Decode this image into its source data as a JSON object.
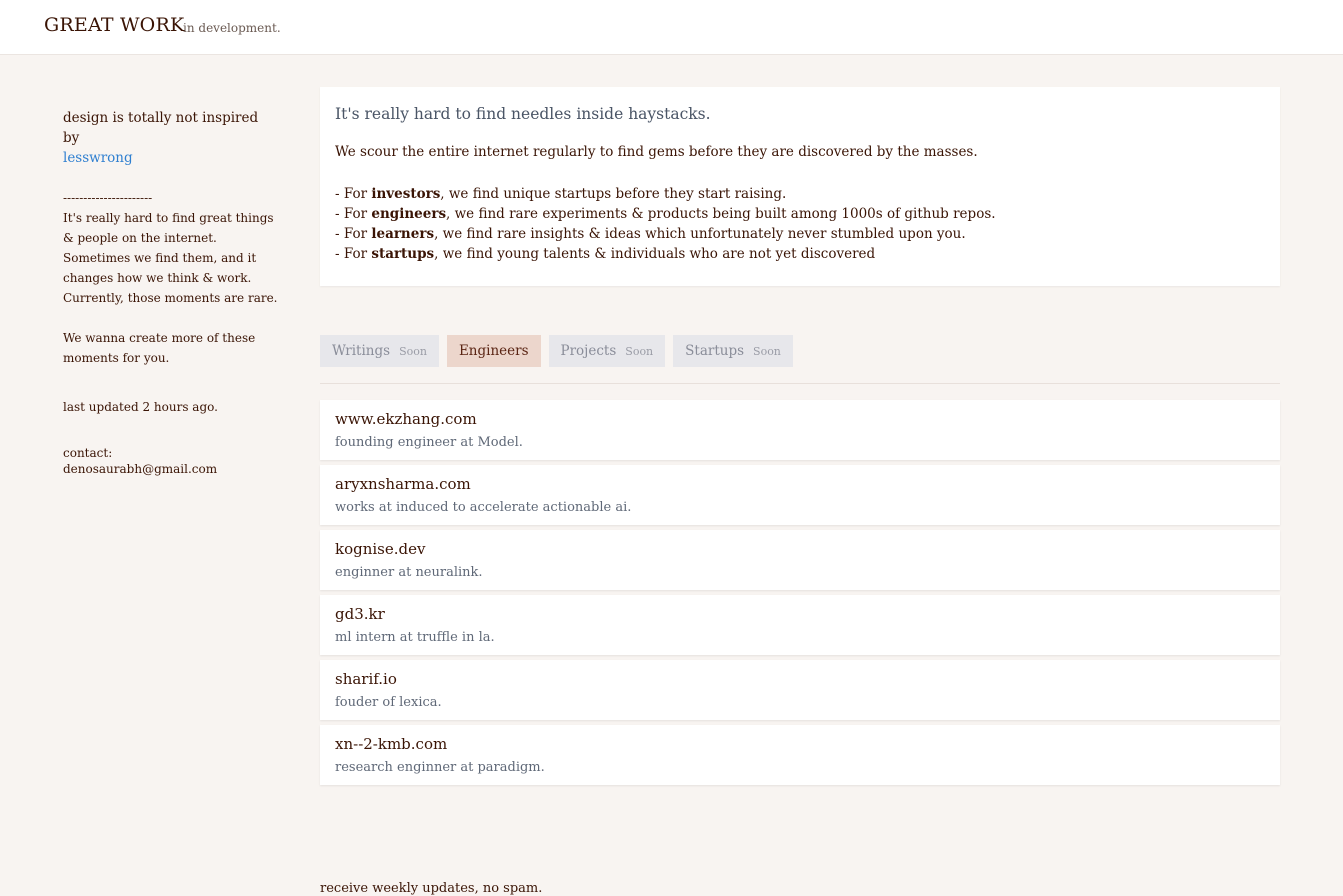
{
  "header": {
    "brand": "GREAT WORK",
    "subtitle": "in development."
  },
  "sidebar": {
    "intro_text": "design is totally not inspired by",
    "intro_link": "lesswrong",
    "separator": "----------------------",
    "para1": "It's really hard to find great things & people on the internet.",
    "para2": "Sometimes we find them, and it changes how we think & work.",
    "para3": "Currently, those moments are rare.",
    "para4": "We wanna create more of these moments for you.",
    "last_updated": "last updated 2 hours ago.",
    "contact_label": "contact:",
    "contact_email": "denosaurabh@gmail.com"
  },
  "intro_card": {
    "headline": "It's really hard to find needles inside haystacks.",
    "lead": "We scour the entire internet regularly to find gems before they are discovered by the masses.",
    "bullets": [
      {
        "prefix": "- For ",
        "keyword": "investors",
        "rest": ", we find unique startups before they start raising."
      },
      {
        "prefix": "- For ",
        "keyword": "engineers",
        "rest": ", we find rare experiments & products being built among 1000s of github repos."
      },
      {
        "prefix": "- For ",
        "keyword": "learners",
        "rest": ", we find rare insights & ideas which unfortunately never stumbled upon you."
      },
      {
        "prefix": "- For ",
        "keyword": "startups",
        "rest": ", we find young talents & individuals who are not yet discovered"
      }
    ]
  },
  "tabs": [
    {
      "label": "Writings",
      "badge": "Soon",
      "active": false
    },
    {
      "label": "Engineers",
      "badge": "",
      "active": true
    },
    {
      "label": "Projects",
      "badge": "Soon",
      "active": false
    },
    {
      "label": "Startups",
      "badge": "Soon",
      "active": false
    }
  ],
  "engineers": [
    {
      "site": "www.ekzhang.com",
      "desc": "founding engineer at Model."
    },
    {
      "site": "aryxnsharma.com",
      "desc": "works at induced to accelerate actionable ai."
    },
    {
      "site": "kognise.dev",
      "desc": "enginner at neuralink."
    },
    {
      "site": "gd3.kr",
      "desc": "ml intern at truffle in la."
    },
    {
      "site": "sharif.io",
      "desc": "fouder of lexica."
    },
    {
      "site": "xn--2-kmb.com",
      "desc": "research enginner at paradigm."
    }
  ],
  "footer": {
    "subscribe_text": "receive weekly updates, no spam."
  },
  "colors": {
    "background": "#f8f4f1",
    "text": "#3a1405",
    "link": "#2f7fd0",
    "active_tab": "#ecd6cc",
    "inactive_tab": "#e7e7eb"
  }
}
